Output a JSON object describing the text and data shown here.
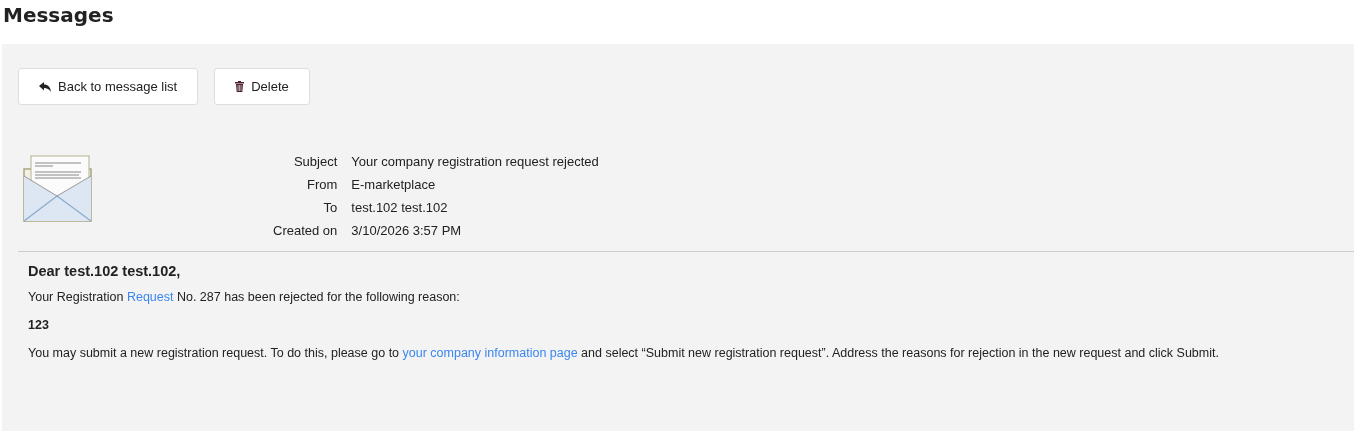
{
  "page_title": "Messages",
  "toolbar": [
    {
      "kind": "back",
      "label": "Back to message list"
    },
    {
      "kind": "delete",
      "label": "Delete"
    }
  ],
  "details": [
    {
      "label": "Subject",
      "value": "Your company registration request rejected"
    },
    {
      "label": "From",
      "value": "E-marketplace"
    },
    {
      "label": "To",
      "value": "test.102 test.102"
    },
    {
      "label": "Created on",
      "value": "3/10/2026 3:57 PM"
    }
  ],
  "body": [
    {
      "kind": "heading",
      "parts": [
        {
          "kind": "text",
          "text": "Dear test.102 test.102,"
        }
      ]
    },
    {
      "kind": "paragraph",
      "parts": [
        {
          "kind": "text",
          "text": "Your Registration "
        },
        {
          "kind": "link",
          "text": "Request"
        },
        {
          "kind": "text",
          "text": " No. 287 has been rejected for the following reason:"
        }
      ]
    },
    {
      "kind": "reason",
      "parts": [
        {
          "kind": "text",
          "text": "123"
        }
      ]
    },
    {
      "kind": "paragraph",
      "parts": [
        {
          "kind": "text",
          "text": "You may submit a new registration request. To do this, please go to "
        },
        {
          "kind": "link",
          "text": "your company information page"
        },
        {
          "kind": "text",
          "text": " and select “Submit new registration request”. Address the reasons for rejection in the new request and click Submit."
        }
      ]
    }
  ]
}
